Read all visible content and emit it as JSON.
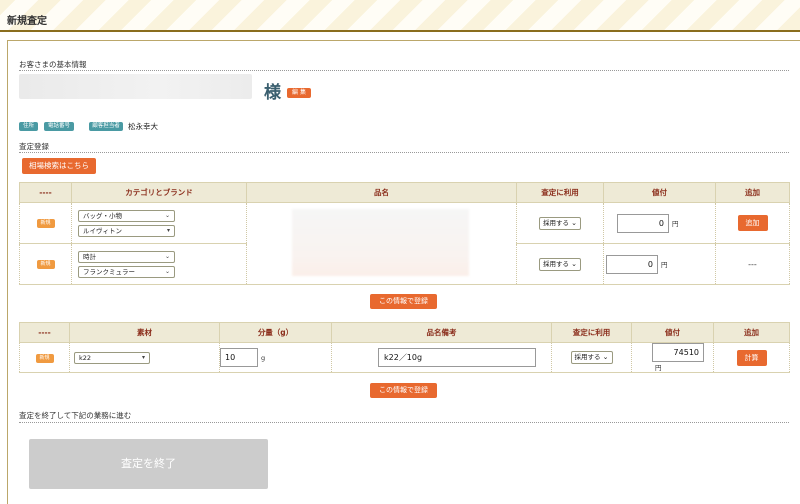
{
  "header": {
    "title": "新規査定"
  },
  "customer": {
    "section_title": "お客さまの基本情報",
    "honorific": "様",
    "edit_label": "編 集",
    "tags": [
      "住所",
      "電話番号",
      "顧客担当者"
    ],
    "staff_name": "松永幸大"
  },
  "assessment": {
    "section_title": "査定登録",
    "market_search_label": "相場検索はこちら",
    "product_table": {
      "headers": [
        "----",
        "カテゴリとブランド",
        "品名",
        "査定に利用",
        "値付",
        "追加"
      ],
      "rows": [
        {
          "badge": "新規",
          "category": "バッグ・小物",
          "brand": "ルイヴィトン",
          "adopt": "採用する",
          "price": "0",
          "unit": "円",
          "action": "追加"
        },
        {
          "badge": "新規",
          "category": "時計",
          "brand": "フランクミュラー",
          "adopt": "採用する",
          "price": "0",
          "unit": "円",
          "action": "---"
        }
      ],
      "register_label": "この情報で登録"
    },
    "material_table": {
      "headers": [
        "----",
        "素材",
        "分量（g）",
        "品名備考",
        "査定に利用",
        "値付",
        "追加"
      ],
      "rows": [
        {
          "badge": "新規",
          "material": "k22",
          "quantity": "10",
          "quantity_unit": "g",
          "note": "k22／10g",
          "adopt": "採用する",
          "price": "74510",
          "unit": "円",
          "action": "計算"
        }
      ],
      "register_label": "この情報で登録"
    }
  },
  "finish": {
    "section_title": "査定を終了して下記の業務に進む",
    "button_label": "査定を終了"
  },
  "icons": {
    "select_chevron": "chevron-down-icon"
  },
  "colors": {
    "accent": "#e8692f",
    "header_text": "#8b2e1c",
    "tag": "#4a9aa3",
    "disabled": "#cccccc"
  }
}
